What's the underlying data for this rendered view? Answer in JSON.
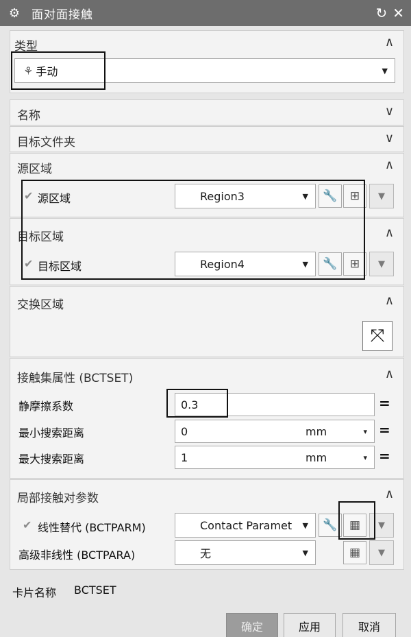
{
  "window": {
    "title": "面对面接触"
  },
  "type_section": {
    "header": "类型",
    "selected": "手动"
  },
  "name_section": {
    "header": "名称"
  },
  "target_folder_section": {
    "header": "目标文件夹"
  },
  "source_section": {
    "header": "源区域",
    "row_label": "源区域",
    "value": "Region3"
  },
  "target_section": {
    "header": "目标区域",
    "row_label": "目标区域",
    "value": "Region4"
  },
  "swap_section": {
    "header": "交换区域"
  },
  "contact_set_section": {
    "header": "接触集属性 (BCTSET)",
    "rows": [
      {
        "label": "静摩擦系数",
        "value": "0.3",
        "unit": ""
      },
      {
        "label": "最小搜索距离",
        "value": "0",
        "unit": "mm"
      },
      {
        "label": "最大搜索距离",
        "value": "1",
        "unit": "mm"
      }
    ]
  },
  "local_params_section": {
    "header": "局部接触对参数",
    "rows": [
      {
        "label": "线性替代 (BCTPARM)",
        "value": "Contact Paramet"
      },
      {
        "label": "高级非线性 (BCTPARA)",
        "value": "无"
      }
    ]
  },
  "card_name": {
    "label": "卡片名称",
    "value": "BCTSET"
  },
  "buttons": {
    "ok": "确定",
    "apply": "应用",
    "cancel": "取消"
  },
  "icons": [
    "gear-icon",
    "reset-icon",
    "close-icon",
    "chevron-up-icon",
    "chevron-down-icon",
    "wrench-icon",
    "select-region-icon",
    "swap-icon",
    "edit-table-icon",
    "check-icon",
    "dropdown-arrow-icon"
  ],
  "colors": {
    "title_bar": "#6d6d6d",
    "panel": "#f3f3f3",
    "background": "#e6e6e6"
  }
}
